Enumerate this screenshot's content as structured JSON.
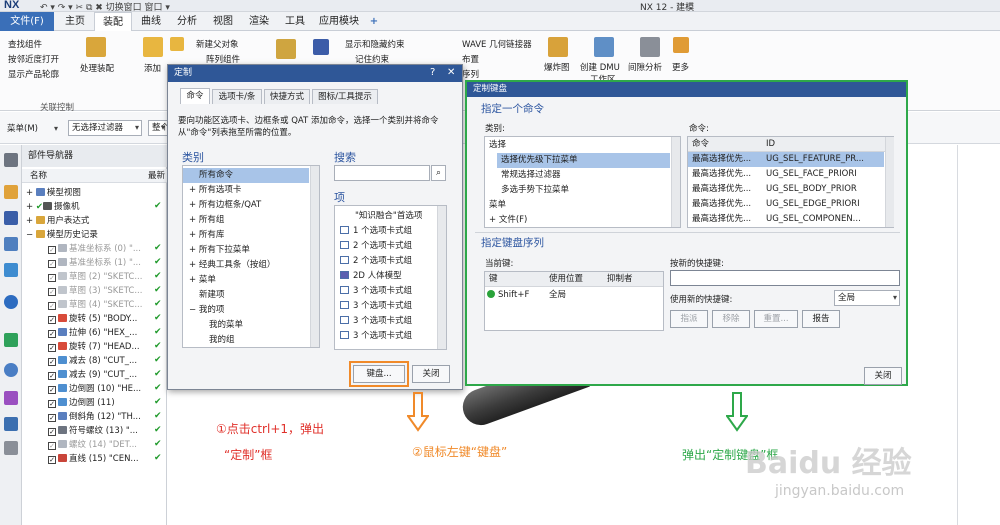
{
  "app": {
    "logo": "NX",
    "quick_access": "↶ ▾ ↷ ▾   ✂ ⧉ ✖   切换窗口  窗口 ▾",
    "window_title": "NX 12 - 建模"
  },
  "menu": {
    "file": "文件(F)",
    "tabs": [
      "主页",
      "装配",
      "曲线",
      "分析",
      "视图",
      "渲染",
      "工具",
      "应用模块"
    ],
    "plus": "+"
  },
  "ribbon": {
    "find_component": "查找组件",
    "open_by_proximity": "按邻近度打开",
    "show_product_outline": "显示产品轮廓",
    "assembly_load": "处理装配",
    "add": "添加",
    "new_parent": "新建父对象",
    "array_component": "阵列组件",
    "show_hide_constraints": "显示和隐藏约束",
    "remember_constraints": "记住约束",
    "wave_linker": "WAVE 几何链接器",
    "layout": "布置",
    "sequence": "序列",
    "exploded_view": "爆炸图",
    "create_dmu": "创建 DMU",
    "workspace": "工作区",
    "clearance": "间隙分析",
    "more": "更多",
    "group_related": "关联控制"
  },
  "filterbar": {
    "menu": "菜单(M)",
    "filter": "无选择过滤器",
    "whole_assembly": "整个装配"
  },
  "navigator": {
    "title": "部件导航器",
    "col_name": "名称",
    "col_latest": "最新",
    "rows": [
      "模型视图",
      "摄像机",
      "用户表达式",
      "模型历史记录",
      "基准坐标系 (0) \"...",
      "基准坐标系 (1) \"...",
      "草图 (2) \"SKETC...",
      "草图 (3) \"SKETC...",
      "草图 (4) \"SKETC...",
      "旋转 (5) \"BODY...",
      "拉伸 (6) \"HEX_...",
      "旋转 (7) \"HEAD...",
      "减去 (8) \"CUT_...",
      "减去 (9) \"CUT_...",
      "边倒圆 (10) \"HE...",
      "边倒圆 (11)",
      "倒斜角 (12) \"TH...",
      "符号螺纹 (13) \"...",
      "螺纹 (14) \"DET...",
      "直线 (15) \"CEN..."
    ]
  },
  "customize_dialog": {
    "title": "定制",
    "help": "?",
    "close": "✕",
    "tabs": [
      "命令",
      "选项卡/条",
      "快捷方式",
      "图标/工具提示"
    ],
    "instruction": "要向功能区选项卡、边框条或 QAT 添加命令，选择一个类别并将命令从\"命令\"列表拖至所需的位置。",
    "category_label": "类别",
    "categories": [
      "所有命令",
      "所有选项卡",
      "所有边框条/QAT",
      "所有组",
      "所有库",
      "所有下拉菜单",
      "经典工具条（按组）",
      "菜单",
      "新建项",
      "我的项",
      "我的菜单",
      "我的组"
    ],
    "search_label": "搜索",
    "search_placeholder": "",
    "items_label": "项",
    "items": [
      "\"知识融合\"首选项",
      "1 个选项卡式组",
      "2 个选项卡式组",
      "2 个选项卡式组",
      "2D 人体模型",
      "3 个选项卡式组",
      "3 个选项卡式组",
      "3 个选项卡式组",
      "3 个选项卡式组"
    ],
    "keyboard_button": "键盘...",
    "close_button": "关闭"
  },
  "keyboard_dialog": {
    "title": "定制键盘",
    "specify_command": "指定一个命令",
    "category_label": "类别:",
    "command_label": "命令:",
    "categories": [
      "选择",
      "选择优先级下拉菜单",
      "常规选择过滤器",
      "多选手势下拉菜单",
      "菜单",
      "文件(F)"
    ],
    "cmd_headers": [
      "命令",
      "ID"
    ],
    "commands": [
      [
        "最高选择优先...",
        "UG_SEL_FEATURE_PR..."
      ],
      [
        "最高选择优先...",
        "UG_SEL_FACE_PRIORI"
      ],
      [
        "最高选择优先...",
        "UG_SEL_BODY_PRIOR"
      ],
      [
        "最高选择优先...",
        "UG_SEL_EDGE_PRIORI"
      ],
      [
        "最高选择优先...",
        "UG_SEL_COMPONEN..."
      ]
    ],
    "specify_sequence": "指定键盘序列",
    "current_keys": "当前键:",
    "key_headers": [
      "键",
      "使用位置",
      "抑制者"
    ],
    "key_row": [
      "Shift+F",
      "全局",
      ""
    ],
    "new_shortcut_label": "按新的快捷键:",
    "new_shortcut_value": "",
    "use_new_label": "使用新的快捷键:",
    "use_new_value": "全局",
    "assign": "指派",
    "remove": "移除",
    "reset": "重置...",
    "report": "报告",
    "close": "关闭"
  },
  "annotations": {
    "step1_line1": "①点击ctrl+1，弹出",
    "step1_line2": "“定制”框",
    "step2": "②鼠标左键“键盘”",
    "step3": "弹出“定制键盘”框",
    "watermark": "Baidu 经验",
    "watermark_url": "jingyan.baidu.com"
  },
  "colors": {
    "accent": "#2f5797",
    "orange": "#f08a2a",
    "green": "#2ea84a",
    "red_text": "#e0302a"
  }
}
